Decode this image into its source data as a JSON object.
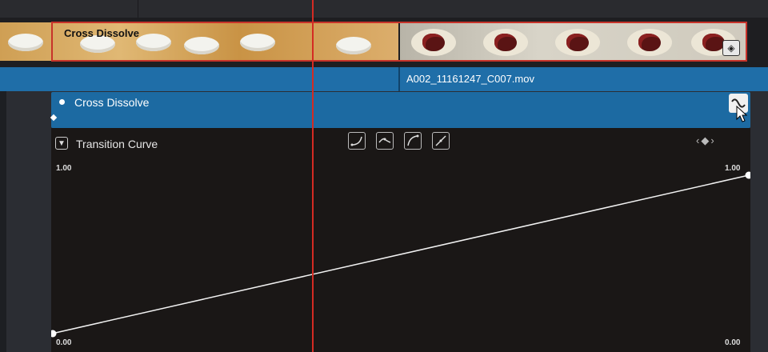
{
  "timeline": {
    "transition_clip_label": "Cross Dissolve",
    "clip_filename": "A002_11161247_C007.mov"
  },
  "inspector": {
    "transition_name": "Cross Dissolve",
    "curve_section_label": "Transition Curve",
    "curve_presets": [
      "ease-in-preset-icon",
      "ease-in-out-preset-icon",
      "ease-out-preset-icon",
      "linear-preset-icon"
    ],
    "nav_arrows": "‹◆›",
    "y_top_left": "1.00",
    "y_top_right": "1.00",
    "y_bottom_left": "0.00",
    "y_bottom_right": "0.00"
  },
  "curve": {
    "start_value": 0.0,
    "end_value": 1.0
  },
  "colors": {
    "playhead": "#d42b23",
    "selection_outline": "#c7332a",
    "clip_blue": "#1f6ea8"
  }
}
